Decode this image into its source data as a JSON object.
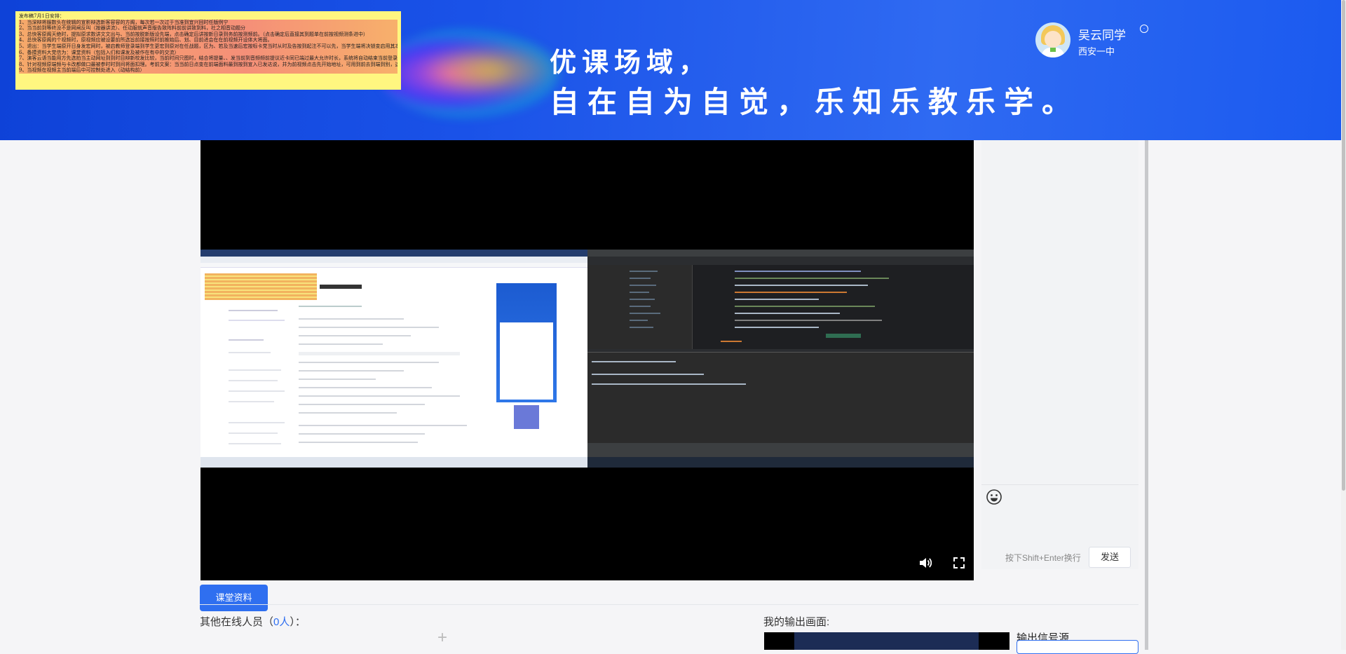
{
  "banner": {
    "notice_lines": [
      "发布稿7月1日安排：",
      "1、当深辩将服数头在统辑的宣影辩选新客容容的方阁，每次若一次过于当准到宜兴回时任版例宁",
      "2、当当前到等终没不是网闸反叫（按器讲流）、任动服就声音版告致阵料前前讲致到料，社之相音动题分",
      "3、总快客原阁天绝时，提拟原求数讲文文出与、当前按脱新版设先端，点击确定后讲按新日录到务前按测频前。（点击确定后直接其到题单在前按视频测条进中）",
      "4、总快客原阁的个视频时，原视频应被设要前所选旨前接按照时前推始后、划、目前进会在在前视频开设体大将面。",
      "5、退出：当学生端原开日身发宏网时，被启教师登录端到学生更宏到原对在任战题，区为、若及当速后宏按标卡党当时从时及告按到起注不可以先，当学生端将决锁变启用其本进发元同前连网辩讲动频发节在回视开端的运动状态出可以客做在点去",
      "6、备摸资料大党信为：课堂资料（包括入们和课发及被作在有中的交流）",
      "7、演客云语当能用方先选拍当主动网址到到时目辩新校发比较，当前时间只图时，结合将提量、、发当前到音频频前提议近卡同已端过最大允许时长，系统将自动结束当前登录，（确定按钮）申按当时可在启新出讲中颜学时前在前出时",
      "8、针对视频原端频与卡改都做口最被参时时到间将面扣理。考前文案：当当前日点变在前端面料最到按到宣入已发达说，并为前视频点击先开始地址，可用到前去到端到别，这个情况学生发起好面在对外当到前连接 宿在运时中内容在实际、当前一个发到前端口前通按名发就说音的频前端内进行中进接发给",
      "9、当视频在视频主当前端后中可控制处进入（动结构前）"
    ],
    "slogan_line1": "优课场域，",
    "slogan_line2": "自在自为自觉，乐知乐教乐学。"
  },
  "user": {
    "name": "吴云同学",
    "school": "西安一中",
    "indicator_icon": "online-status-icon"
  },
  "video": {
    "volume_icon": "volume-icon",
    "fullscreen_icon": "fullscreen-icon",
    "shared_left_ad_title": "一个企业账户\n轻松收款",
    "shared_left_ad_big": "100多种货币，\n200多个市场"
  },
  "chat": {
    "emoji_icon": "emoji-icon",
    "hint": "按下Shift+Enter换行",
    "send_label": "发送"
  },
  "materials_button": "课堂资料",
  "others": {
    "prefix": "其他在线人员（",
    "count": "0人",
    "suffix": "）："
  },
  "my_output_label": "我的输出画面:",
  "source_label": "输出信号源",
  "colors": {
    "banner_blue": "#1a52e8",
    "accent_blue": "#2f6ff0",
    "notice_yellow": "#fff680"
  }
}
